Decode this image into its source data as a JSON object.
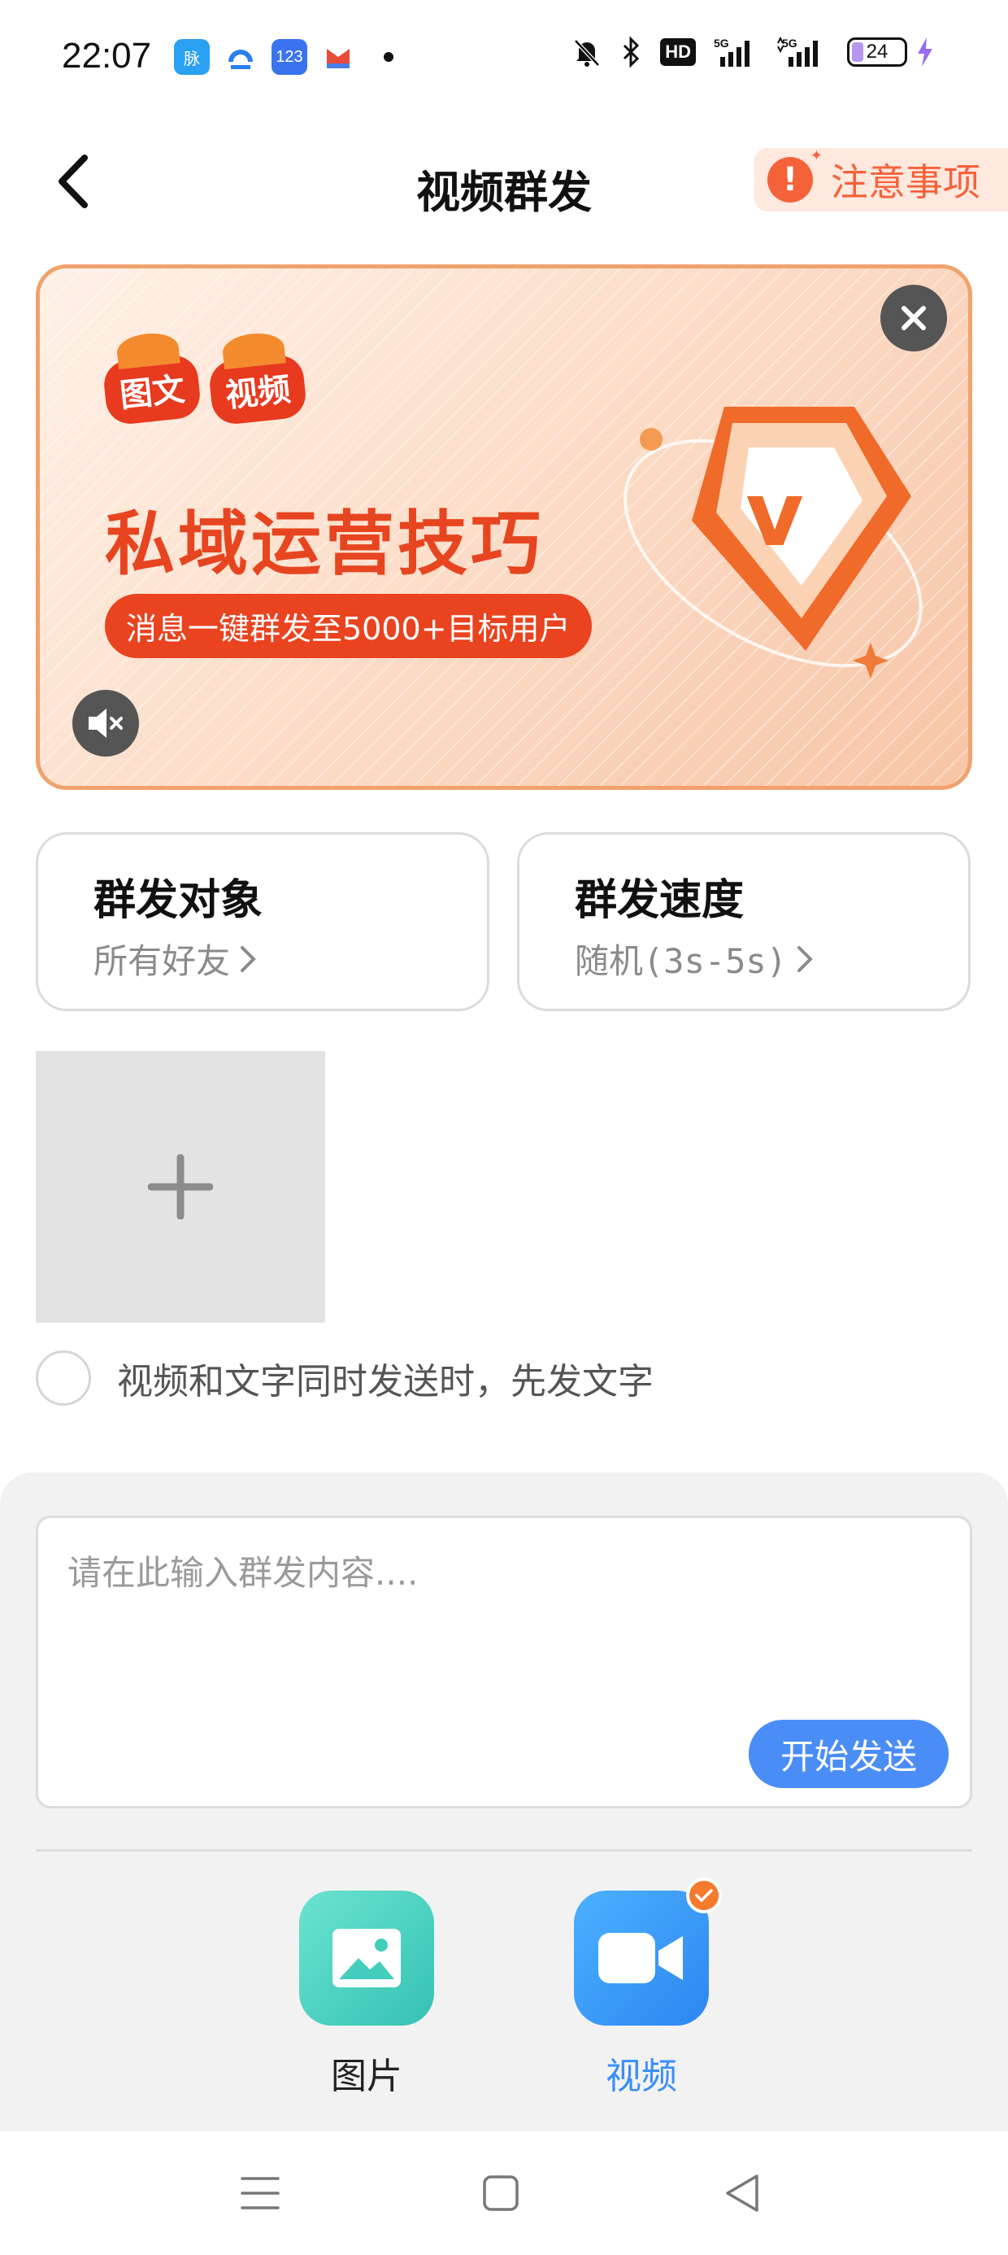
{
  "status_bar": {
    "time": "22:07",
    "app_icons": [
      "maimai-app-icon",
      "finance-app-icon",
      "123-app-icon",
      "calendar-app-icon"
    ],
    "app_icon_labels": [
      "脉",
      "",
      "123",
      ""
    ],
    "network": "5G",
    "network2": "5G",
    "hd": "HD",
    "battery": "24"
  },
  "header": {
    "title": "视频群发",
    "notice_label": "注意事项"
  },
  "banner": {
    "tags": [
      "图文",
      "视频"
    ],
    "title": "私域运营技巧",
    "pill": "消息一键群发至5000+目标用户",
    "logo_letter": "v"
  },
  "settings": {
    "target_title": "群发对象",
    "target_value": "所有好友",
    "speed_title": "群发速度",
    "speed_value": "随机(3s-5s)"
  },
  "option": {
    "label": "视频和文字同时发送时，先发文字",
    "checked": false
  },
  "message": {
    "placeholder": "请在此输入群发内容....",
    "value": "",
    "send_label": "开始发送"
  },
  "media": {
    "image_label": "图片",
    "video_label": "视频",
    "selected": "video"
  },
  "colors": {
    "accent": "#4a8df7",
    "notice": "#f4623a",
    "banner_border": "#f0a26e",
    "video_active": "#3a8ef6"
  }
}
